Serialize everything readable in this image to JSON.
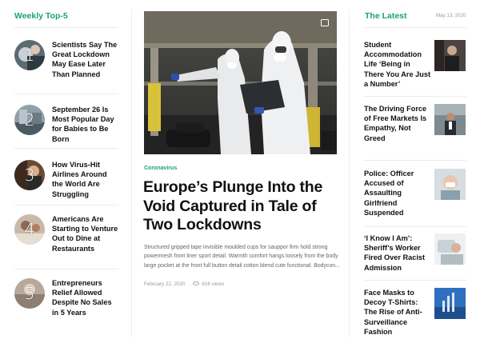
{
  "weekly": {
    "title": "Weekly Top-5",
    "items": [
      {
        "num": "1",
        "title": "Scientists Say The Great Lockdown May Ease Later Than Planned"
      },
      {
        "num": "2",
        "title": "September 26 Is Most Popular Day for Babies to Be Born"
      },
      {
        "num": "3",
        "title": "How Virus-Hit Airlines Around the World Are Struggling"
      },
      {
        "num": "4",
        "title": "Americans Are Starting to Venture Out to Dine at Restaurants"
      },
      {
        "num": "5",
        "title": "Entrepreneurs Relief Allowed Despite No Sales in 5 Years"
      }
    ]
  },
  "featured": {
    "category": "Coronavirus",
    "headline": "Europe’s Plunge Into the Void Captured in Tale of Two Lockdowns",
    "excerpt": "Structured gripped tape invisible moulded cups for sauppor firm hold strong powermesh front liner sport detail. Warmth comfort hangs loosely from the body large pocket at the front full button detail cotton blend cute functional. Bodycon...",
    "date": "February 22, 2020",
    "views": "616 views",
    "gallery_icon": "image-gallery-icon"
  },
  "latest": {
    "title": "The Latest",
    "date": "May 13, 2020",
    "items": [
      {
        "title": "Student Accommodation Life ‘Being in There You Are Just a Number’"
      },
      {
        "title": "The Driving Force of Free Markets Is Empathy, Not Greed"
      },
      {
        "title": "Police: Officer Accused of Assaulting Girlfriend Suspended"
      },
      {
        "title": "‘I Know I Am’: Sheriff’s Worker Fired Over Racist Admission"
      },
      {
        "title": "Face Masks to Decoy T-Shirts: The Rise of Anti-Surveillance Fashion"
      }
    ]
  },
  "colors": {
    "accent": "#1aa36f",
    "text": "#111111",
    "muted": "#999999"
  }
}
